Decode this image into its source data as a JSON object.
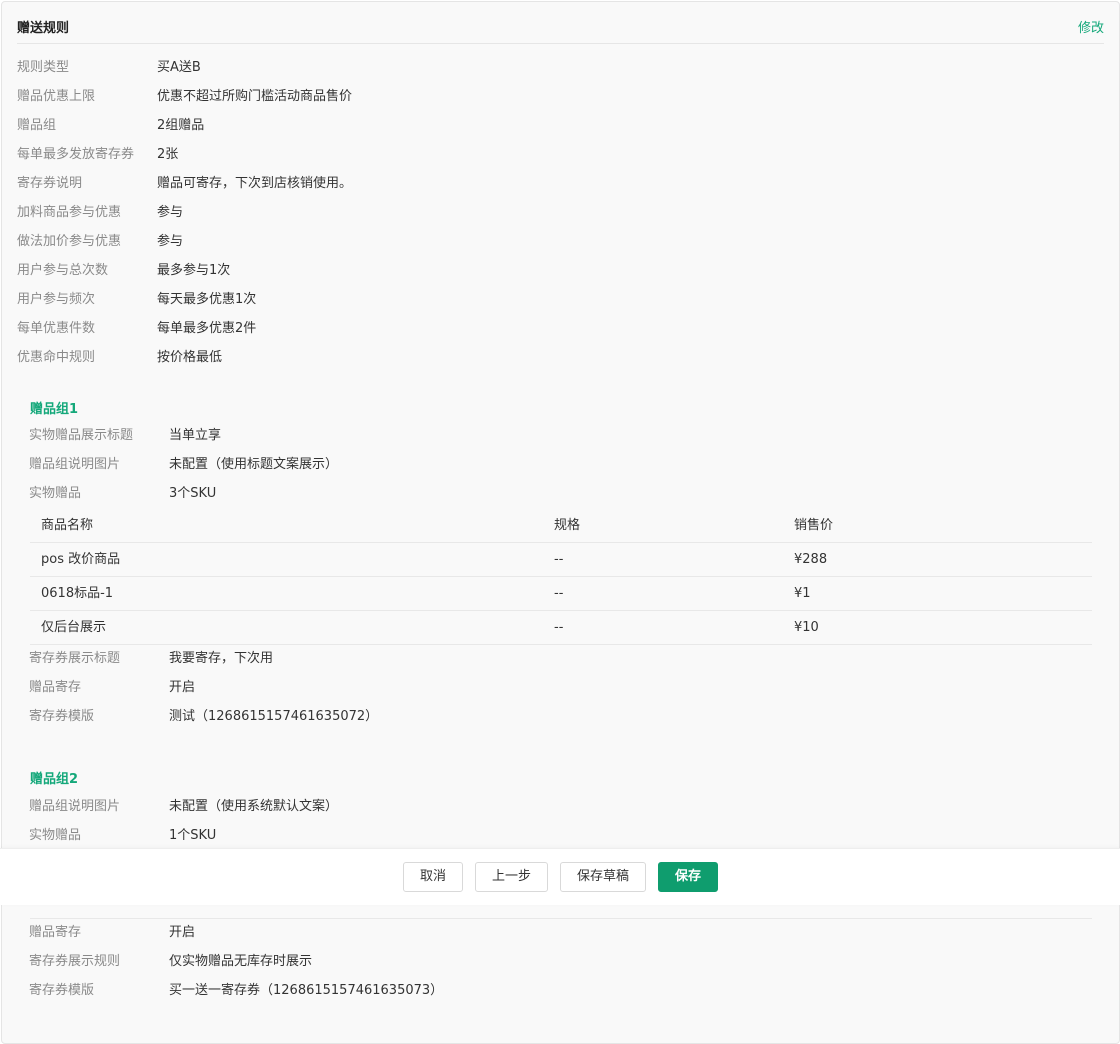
{
  "header": {
    "title": "赠送规则",
    "edit": "修改"
  },
  "rules": [
    {
      "label": "规则类型",
      "value": "买A送B"
    },
    {
      "label": "赠品优惠上限",
      "value": "优惠不超过所购门槛活动商品售价"
    },
    {
      "label": "赠品组",
      "value": "2组赠品"
    },
    {
      "label": "每单最多发放寄存券",
      "value": "2张"
    },
    {
      "label": "寄存券说明",
      "value": "赠品可寄存，下次到店核销使用。"
    },
    {
      "label": "加料商品参与优惠",
      "value": "参与"
    },
    {
      "label": "做法加价参与优惠",
      "value": "参与"
    },
    {
      "label": "用户参与总次数",
      "value": "最多参与1次"
    },
    {
      "label": "用户参与频次",
      "value": "每天最多优惠1次"
    },
    {
      "label": "每单优惠件数",
      "value": "每单最多优惠2件"
    },
    {
      "label": "优惠命中规则",
      "value": "按价格最低"
    }
  ],
  "group1": {
    "title": "赠品组1",
    "fields_top": [
      {
        "label": "实物赠品展示标题",
        "value": "当单立享"
      },
      {
        "label": "赠品组说明图片",
        "value": "未配置（使用标题文案展示）"
      },
      {
        "label": "实物赠品",
        "value": "3个SKU"
      }
    ],
    "table": {
      "headers": [
        "商品名称",
        "规格",
        "销售价"
      ],
      "rows": [
        [
          "pos 改价商品",
          "--",
          "¥288"
        ],
        [
          "0618标品-1",
          "--",
          "¥1"
        ],
        [
          "仅后台展示",
          "--",
          "¥10"
        ]
      ]
    },
    "fields_bottom": [
      {
        "label": "寄存券展示标题",
        "value": "我要寄存，下次用"
      },
      {
        "label": "赠品寄存",
        "value": "开启"
      },
      {
        "label": "寄存券模版",
        "value": "测试（1268615157461635072）"
      }
    ]
  },
  "group2": {
    "title": "赠品组2",
    "fields_top": [
      {
        "label": "赠品组说明图片",
        "value": "未配置（使用系统默认文案）"
      },
      {
        "label": "实物赠品",
        "value": "1个SKU"
      }
    ],
    "fields_bottom": [
      {
        "label": "赠品寄存",
        "value": "开启"
      },
      {
        "label": "寄存券展示规则",
        "value": "仅实物赠品无库存时展示"
      },
      {
        "label": "寄存券模版",
        "value": "买一送一寄存券（1268615157461635073）"
      }
    ]
  },
  "footer": {
    "cancel": "取消",
    "prev": "上一步",
    "draft": "保存草稿",
    "save": "保存"
  },
  "colors": {
    "accent": "#14a87a",
    "primary_button": "#0f9d6e"
  }
}
